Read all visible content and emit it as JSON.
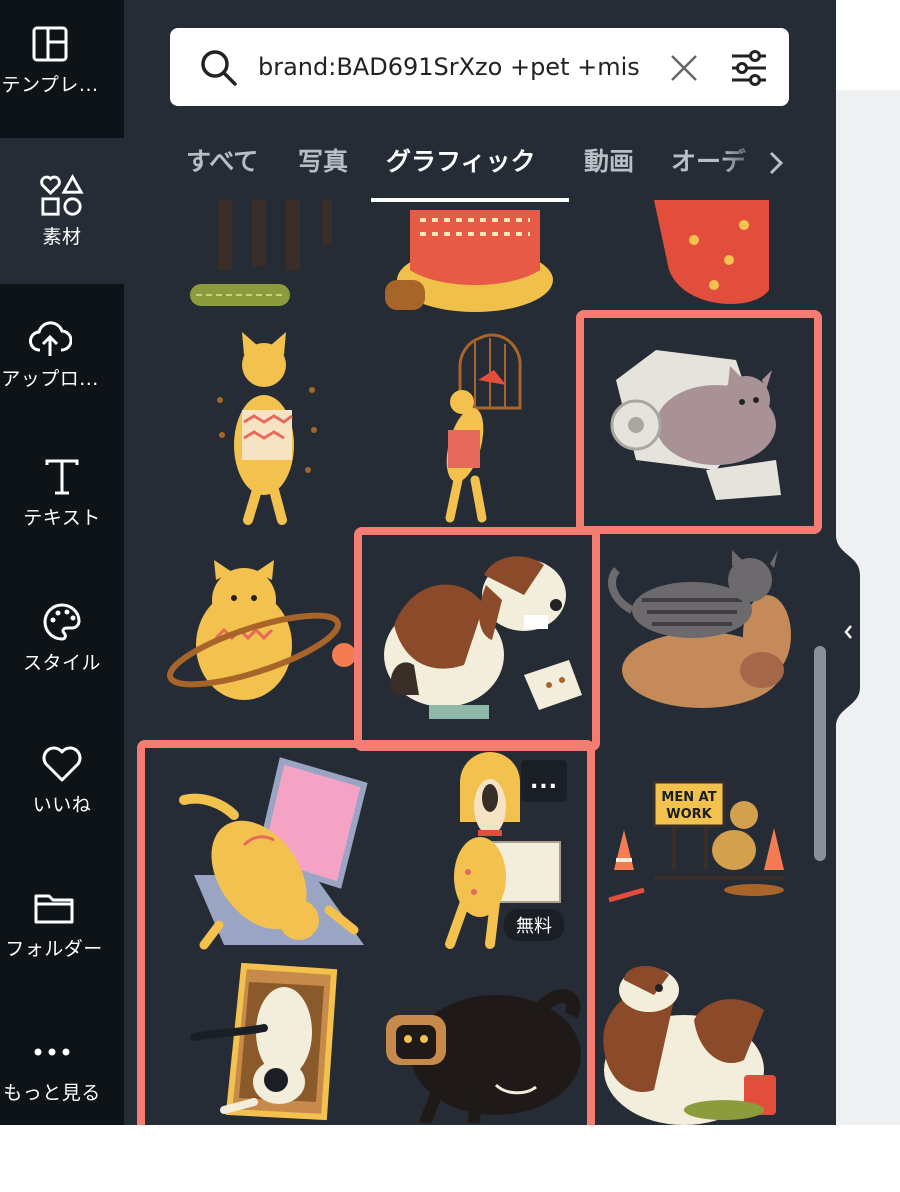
{
  "sidebar": {
    "items": [
      {
        "label": "テンプレ...",
        "icon": "template-icon"
      },
      {
        "label": "素材",
        "icon": "elements-icon"
      },
      {
        "label": "アップロ...",
        "icon": "cloud-upload-icon"
      },
      {
        "label": "テキスト",
        "icon": "text-icon"
      },
      {
        "label": "スタイル",
        "icon": "palette-icon"
      },
      {
        "label": "いいね",
        "icon": "heart-icon"
      },
      {
        "label": "フォルダー",
        "icon": "folder-icon"
      },
      {
        "label": "もっと見る",
        "icon": "more-icon"
      }
    ],
    "active": "素材"
  },
  "search": {
    "value": "brand:BAD691SrXzo +pet +mis"
  },
  "tabs": {
    "items": [
      "すべて",
      "写真",
      "グラフィック",
      "動画",
      "オーデ"
    ],
    "active": "グラフィック"
  },
  "results": {
    "free_badge": "無料",
    "more_button": "...",
    "sign_text": "MEN AT WORK"
  },
  "colors": {
    "panel_bg": "#252c35",
    "sidebar_bg": "#0e1318",
    "highlight": "#f47c72"
  }
}
